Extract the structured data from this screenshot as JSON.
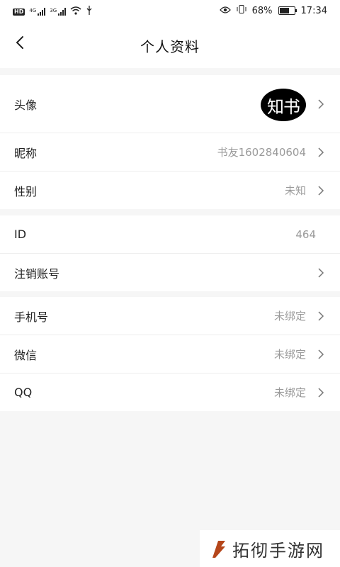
{
  "status_bar": {
    "network_badge": "HD",
    "signal1_tag": "4G",
    "signal2_tag": "3G",
    "battery_percent": "68%",
    "battery_level": 0.68,
    "time": "17:34"
  },
  "header": {
    "title": "个人资料",
    "back_icon": "chevron-left-icon"
  },
  "profile": {
    "avatar_label": "头像",
    "avatar_text": "知书",
    "nickname_label": "昵称",
    "nickname_value": "书友1602840604",
    "gender_label": "性别",
    "gender_value": "未知"
  },
  "account": {
    "id_label": "ID",
    "id_value": "464",
    "cancel_label": "注销账号"
  },
  "bindings": {
    "phone_label": "手机号",
    "phone_value": "未绑定",
    "wechat_label": "微信",
    "wechat_value": "未绑定",
    "qq_label": "QQ",
    "qq_value": "未绑定"
  },
  "watermark": {
    "text": "拓彻手游网",
    "logo_color": "#b5461b"
  },
  "colors": {
    "background": "#f6f6f6",
    "value_gray": "#9a9a9a",
    "avatar_bg": "#000000"
  }
}
